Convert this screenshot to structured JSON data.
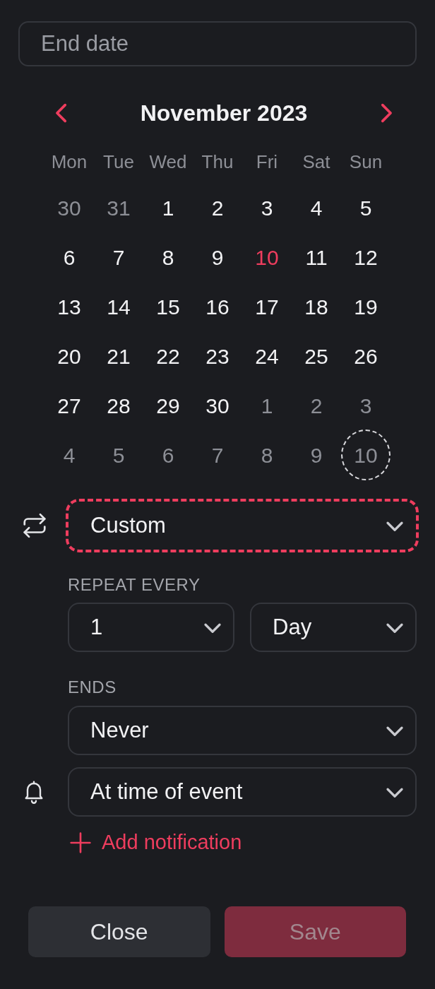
{
  "end_date": {
    "placeholder": "End date"
  },
  "calendar": {
    "month": "November 2023",
    "weekdays": [
      "Mon",
      "Tue",
      "Wed",
      "Thu",
      "Fri",
      "Sat",
      "Sun"
    ],
    "days": [
      {
        "label": "30",
        "in_month": false,
        "today": false,
        "selected": false
      },
      {
        "label": "31",
        "in_month": false,
        "today": false,
        "selected": false
      },
      {
        "label": "1",
        "in_month": true,
        "today": false,
        "selected": false
      },
      {
        "label": "2",
        "in_month": true,
        "today": false,
        "selected": false
      },
      {
        "label": "3",
        "in_month": true,
        "today": false,
        "selected": false
      },
      {
        "label": "4",
        "in_month": true,
        "today": false,
        "selected": false
      },
      {
        "label": "5",
        "in_month": true,
        "today": false,
        "selected": false
      },
      {
        "label": "6",
        "in_month": true,
        "today": false,
        "selected": false
      },
      {
        "label": "7",
        "in_month": true,
        "today": false,
        "selected": false
      },
      {
        "label": "8",
        "in_month": true,
        "today": false,
        "selected": false
      },
      {
        "label": "9",
        "in_month": true,
        "today": false,
        "selected": false
      },
      {
        "label": "10",
        "in_month": true,
        "today": true,
        "selected": false
      },
      {
        "label": "11",
        "in_month": true,
        "today": false,
        "selected": false
      },
      {
        "label": "12",
        "in_month": true,
        "today": false,
        "selected": false
      },
      {
        "label": "13",
        "in_month": true,
        "today": false,
        "selected": false
      },
      {
        "label": "14",
        "in_month": true,
        "today": false,
        "selected": false
      },
      {
        "label": "15",
        "in_month": true,
        "today": false,
        "selected": false
      },
      {
        "label": "16",
        "in_month": true,
        "today": false,
        "selected": false
      },
      {
        "label": "17",
        "in_month": true,
        "today": false,
        "selected": false
      },
      {
        "label": "18",
        "in_month": true,
        "today": false,
        "selected": false
      },
      {
        "label": "19",
        "in_month": true,
        "today": false,
        "selected": false
      },
      {
        "label": "20",
        "in_month": true,
        "today": false,
        "selected": false
      },
      {
        "label": "21",
        "in_month": true,
        "today": false,
        "selected": false
      },
      {
        "label": "22",
        "in_month": true,
        "today": false,
        "selected": false
      },
      {
        "label": "23",
        "in_month": true,
        "today": false,
        "selected": false
      },
      {
        "label": "24",
        "in_month": true,
        "today": false,
        "selected": false
      },
      {
        "label": "25",
        "in_month": true,
        "today": false,
        "selected": false
      },
      {
        "label": "26",
        "in_month": true,
        "today": false,
        "selected": false
      },
      {
        "label": "27",
        "in_month": true,
        "today": false,
        "selected": false
      },
      {
        "label": "28",
        "in_month": true,
        "today": false,
        "selected": false
      },
      {
        "label": "29",
        "in_month": true,
        "today": false,
        "selected": false
      },
      {
        "label": "30",
        "in_month": true,
        "today": false,
        "selected": false
      },
      {
        "label": "1",
        "in_month": false,
        "today": false,
        "selected": false
      },
      {
        "label": "2",
        "in_month": false,
        "today": false,
        "selected": false
      },
      {
        "label": "3",
        "in_month": false,
        "today": false,
        "selected": false
      },
      {
        "label": "4",
        "in_month": false,
        "today": false,
        "selected": false
      },
      {
        "label": "5",
        "in_month": false,
        "today": false,
        "selected": false
      },
      {
        "label": "6",
        "in_month": false,
        "today": false,
        "selected": false
      },
      {
        "label": "7",
        "in_month": false,
        "today": false,
        "selected": false
      },
      {
        "label": "8",
        "in_month": false,
        "today": false,
        "selected": false
      },
      {
        "label": "9",
        "in_month": false,
        "today": false,
        "selected": false
      },
      {
        "label": "10",
        "in_month": false,
        "today": false,
        "selected": true
      }
    ]
  },
  "repeat": {
    "value": "Custom",
    "focused": true
  },
  "repeat_every": {
    "label": "REPEAT EVERY",
    "count": "1",
    "unit": "Day"
  },
  "ends": {
    "label": "ENDS",
    "value": "Never"
  },
  "notification": {
    "value": "At time of event"
  },
  "add_notification": "Add notification",
  "buttons": [
    {
      "label": "Close",
      "kind": "secondary",
      "disabled": false
    },
    {
      "label": "Save",
      "kind": "primary",
      "disabled": true
    }
  ]
}
